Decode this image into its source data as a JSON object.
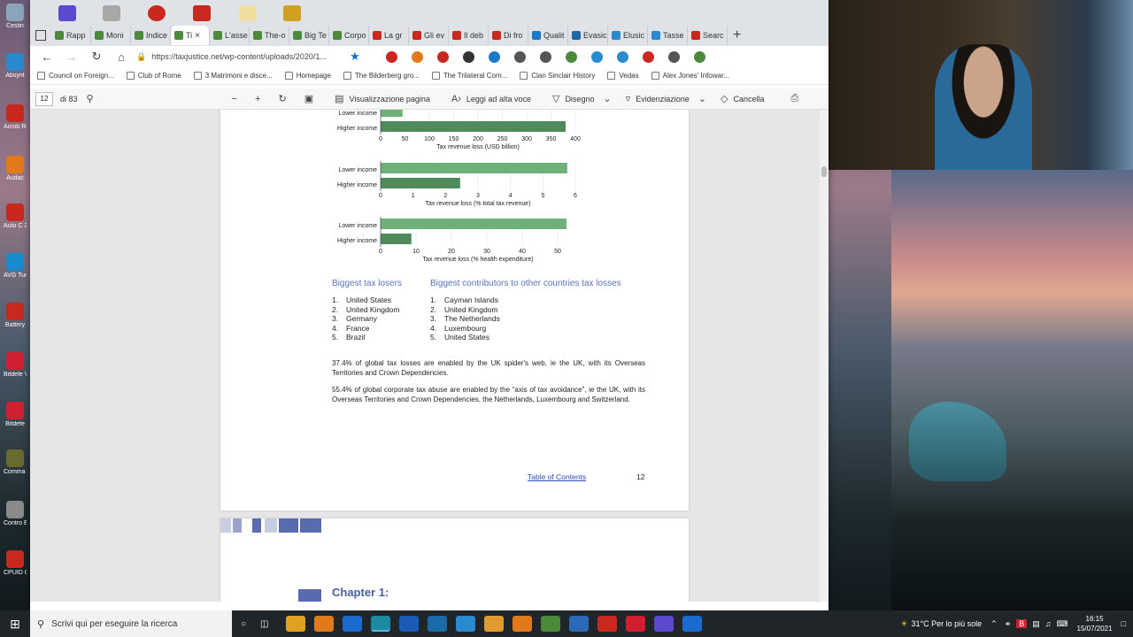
{
  "desktop": {
    "icons": [
      {
        "label": "Cestin",
        "color": "#8aa4b8"
      },
      {
        "label": "Absynt",
        "color": "#2a8ad0"
      },
      {
        "label": "Acrob Reader",
        "color": "#c8281e"
      },
      {
        "label": "Audac",
        "color": "#e07a1a"
      },
      {
        "label": "Auto C 2015",
        "color": "#c8281e"
      },
      {
        "label": "AVG Tun",
        "color": "#1a8ad0"
      },
      {
        "label": "Battery",
        "color": "#c8281e"
      },
      {
        "label": "Bitdefe VPN",
        "color": "#d02030"
      },
      {
        "label": "Bitdefe",
        "color": "#d02030"
      },
      {
        "label": "Comma Conque",
        "color": "#6a6a30"
      },
      {
        "label": "Contro Edito",
        "color": "#8a8a8a"
      },
      {
        "label": "CPUID CPU-",
        "color": "#c8281e"
      }
    ]
  },
  "browser": {
    "tabs": [
      {
        "label": "Rapp",
        "color": "#4a8a3a"
      },
      {
        "label": "Moni",
        "color": "#4a8a3a"
      },
      {
        "label": "Indice",
        "color": "#4a8a3a"
      },
      {
        "label": "Ti",
        "color": "#4a8a3a",
        "active": true
      },
      {
        "label": "L'asse",
        "color": "#4a8a3a"
      },
      {
        "label": "The-o",
        "color": "#4a8a3a"
      },
      {
        "label": "Big Te",
        "color": "#4a8a3a"
      },
      {
        "label": "Corpo",
        "color": "#4a8a3a"
      },
      {
        "label": "La gr",
        "color": "#c8281e"
      },
      {
        "label": "Gli ev",
        "color": "#c8281e"
      },
      {
        "label": "Il deb",
        "color": "#c8281e"
      },
      {
        "label": "Di fro",
        "color": "#c8281e"
      },
      {
        "label": "Qualit",
        "color": "#1a7ac8"
      },
      {
        "label": "Evasic",
        "color": "#1a6aa8"
      },
      {
        "label": "Elusic",
        "color": "#2a8ad0"
      },
      {
        "label": "Tasse",
        "color": "#2a8ad0"
      },
      {
        "label": "Searc",
        "color": "#c8281e"
      }
    ],
    "close_glyph": "×",
    "new_tab_glyph": "+",
    "url": "https://taxjustice.net/wp-content/uploads/2020/1...",
    "favorites": [
      "Council on Foreign...",
      "Club of Rome",
      "3 Matrimoni e disce...",
      "Homepage",
      "The Bilderberg gro...",
      "The Trilateral Com...",
      "Clan Sinclair History",
      "Vedas",
      "Alex Jones' Infowar..."
    ],
    "pdf_toolbar": {
      "page": "12",
      "of_pages": "di 83",
      "page_view": "Visualizzazione pagina",
      "read_aloud": "Leggi ad alta voce",
      "draw": "Disegno",
      "highlight": "Evidenziazione",
      "erase": "Cancella"
    }
  },
  "document": {
    "chart_data": [
      {
        "type": "bar",
        "orientation": "horizontal",
        "categories": [
          "Lower income",
          "Higher income"
        ],
        "values": [
          45,
          380
        ],
        "xlabel": "Tax revenue loss (USD billion)",
        "xlim": [
          0,
          400
        ],
        "ticks": [
          0,
          50,
          100,
          150,
          200,
          250,
          300,
          350,
          400
        ]
      },
      {
        "type": "bar",
        "orientation": "horizontal",
        "categories": [
          "Lower income",
          "Higher income"
        ],
        "values": [
          5.75,
          2.45
        ],
        "xlabel": "Tax revenue loss (% total tax revenue)",
        "xlim": [
          0,
          6
        ],
        "ticks": [
          0,
          1,
          2,
          3,
          4,
          5,
          6
        ]
      },
      {
        "type": "bar",
        "orientation": "horizontal",
        "categories": [
          "Lower income",
          "Higher income"
        ],
        "values": [
          52.5,
          8.7
        ],
        "xlabel": "Tax revenue loss (% health expenditure)",
        "xlim": [
          0,
          55
        ],
        "ticks": [
          0,
          10,
          20,
          30,
          40,
          50
        ]
      }
    ],
    "colors": {
      "lower": "#6fb07a",
      "higher": "#4f8a5c"
    },
    "losers_title": "Biggest tax losers",
    "losers": [
      "United States",
      "United Kingdom",
      "Germany",
      "France",
      "Brazil"
    ],
    "contributors_title": "Biggest contributors to other countries tax losses",
    "contributors": [
      "Cayman Islands",
      "United Kingdom",
      "The Netherlands",
      "Luxembourg",
      "United States"
    ],
    "para1": "37.4% of global tax losses are enabled by the UK spider's web, ie the UK, with its Overseas Territories and Crown Dependencies.",
    "para2": "55.4% of global corporate tax abuse are enabled by the “axis of tax avoidance”, ie the UK, with its Overseas Territories and Crown Dependencies, the Netherlands, Luxembourg and Switzerland.",
    "toc_link": "Table of Contents",
    "page_number": "12",
    "chapter_title": "Chapter 1:"
  },
  "taskbar": {
    "search_placeholder": "Scrivi qui per eseguire la ricerca",
    "weather": "31°C Per lo più sole",
    "time": "16:15",
    "date": "15/07/2021"
  }
}
